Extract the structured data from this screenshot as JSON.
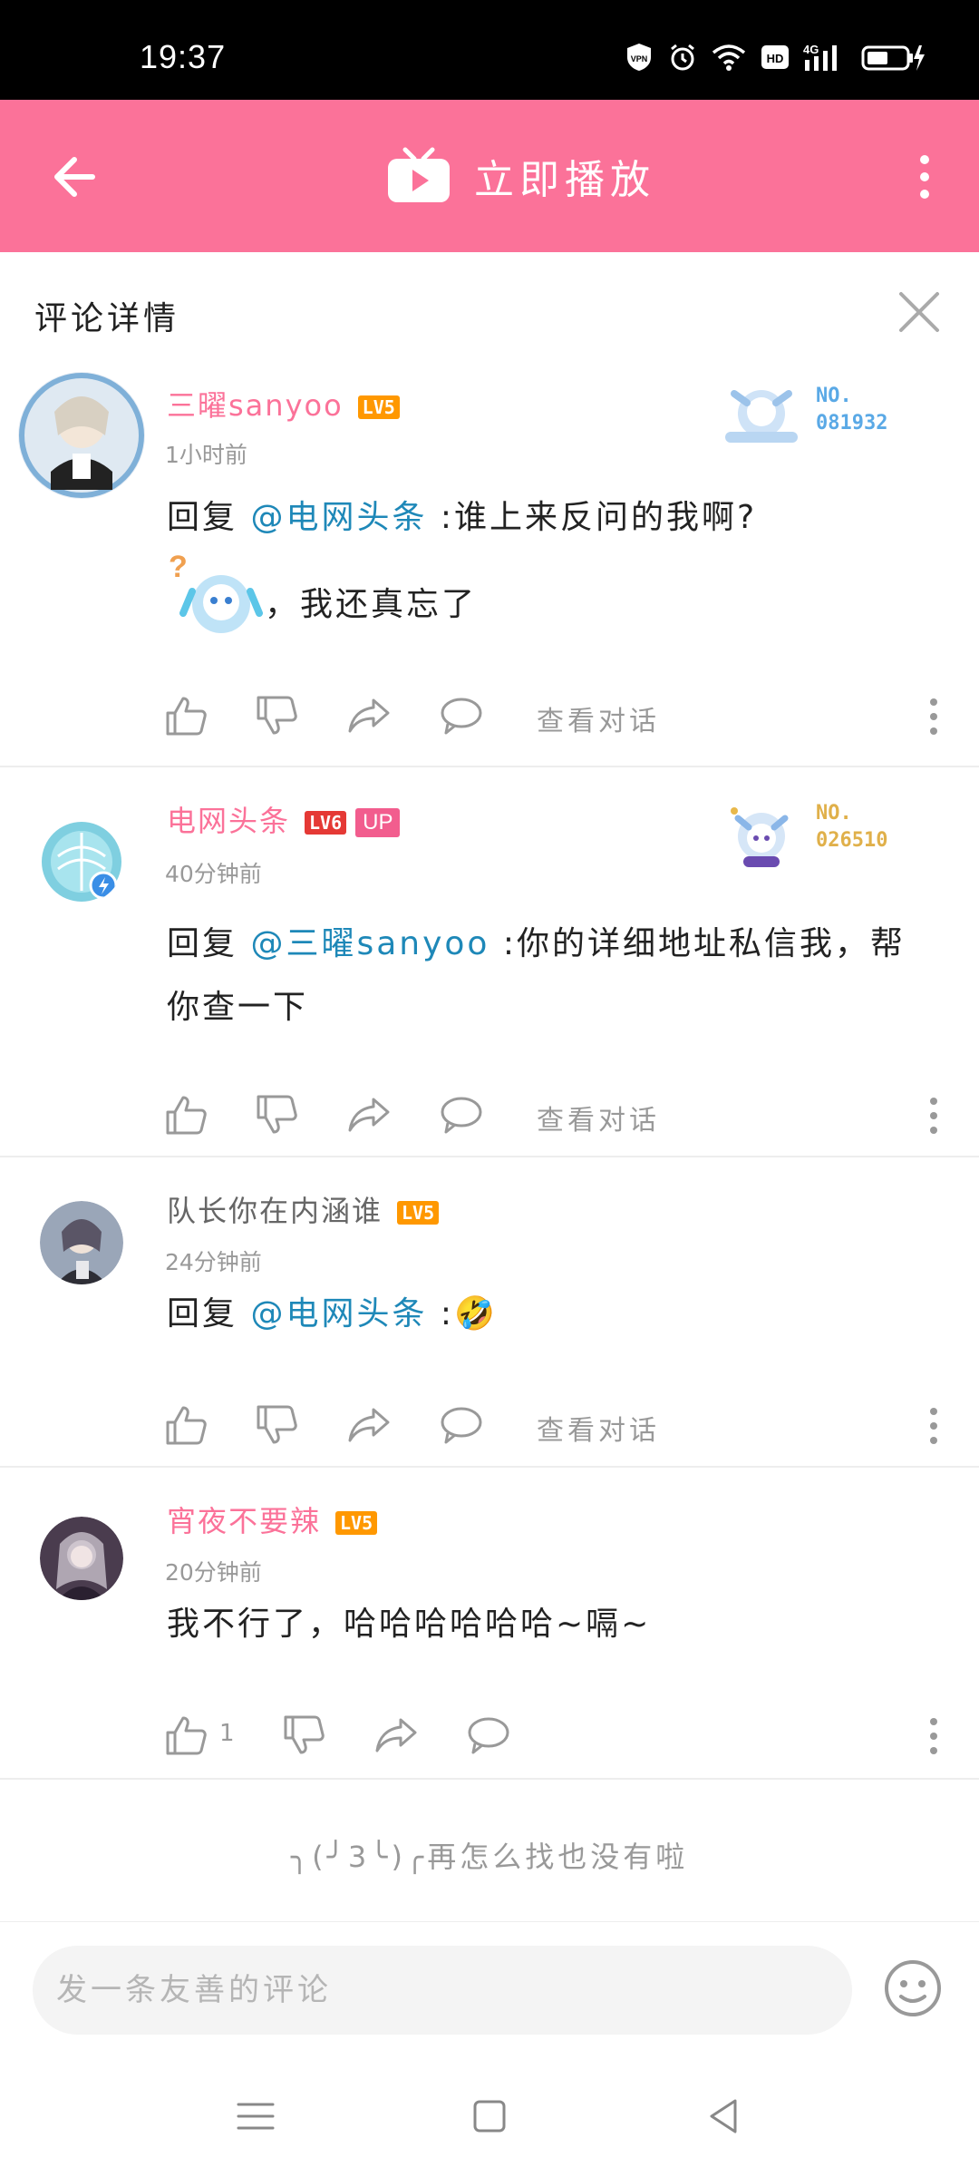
{
  "status_bar": {
    "time": "19:37",
    "vpn_label": "VPN",
    "hd_label": "HD",
    "network_label": "4G"
  },
  "app_bar": {
    "play_now_label": "立即播放"
  },
  "detail_header": {
    "title": "评论详情"
  },
  "comments": [
    {
      "username": "三曜sanyoo",
      "level": "LV5",
      "time": "1小时前",
      "badge_no": "NO.\n081932",
      "badge_color": "#5aa9e6",
      "reply_prefix": "回复 ",
      "mention": "@电网头条",
      "text": " :谁上来反问的我啊?",
      "text_after_sticker": "，我还真忘了",
      "view_conversation": "查看对话"
    },
    {
      "username": "电网头条",
      "level": "LV6",
      "up_badge": "UP",
      "time": "40分钟前",
      "badge_no": "NO.\n026510",
      "badge_color": "#e0b04a",
      "reply_prefix": "回复 ",
      "mention": "@三曜sanyoo",
      "text": " :你的详细地址私信我，帮你查一下",
      "view_conversation": "查看对话"
    },
    {
      "username": "队长你在内涵谁",
      "level": "LV5",
      "time": "24分钟前",
      "reply_prefix": "回复 ",
      "mention": "@电网头条",
      "text": " :🤣",
      "view_conversation": "查看对话"
    },
    {
      "username": "宵夜不要辣",
      "level": "LV5",
      "time": "20分钟前",
      "text": "我不行了，哈哈哈哈哈哈~嗝~",
      "like_count": "1"
    }
  ],
  "end_message": "╮(╯3╰)╭再怎么找也没有啦",
  "input": {
    "placeholder": "发一条友善的评论"
  },
  "colors": {
    "accent_pink": "#fb7299",
    "mention_blue": "#1e88b8"
  },
  "icons": {
    "back": "arrow-left-icon",
    "tv": "tv-play-icon",
    "more": "more-vertical-icon",
    "close": "close-icon",
    "like": "thumb-up-icon",
    "dislike": "thumb-down-icon",
    "share": "share-icon",
    "reply": "comment-icon",
    "emoji": "emoji-icon"
  }
}
